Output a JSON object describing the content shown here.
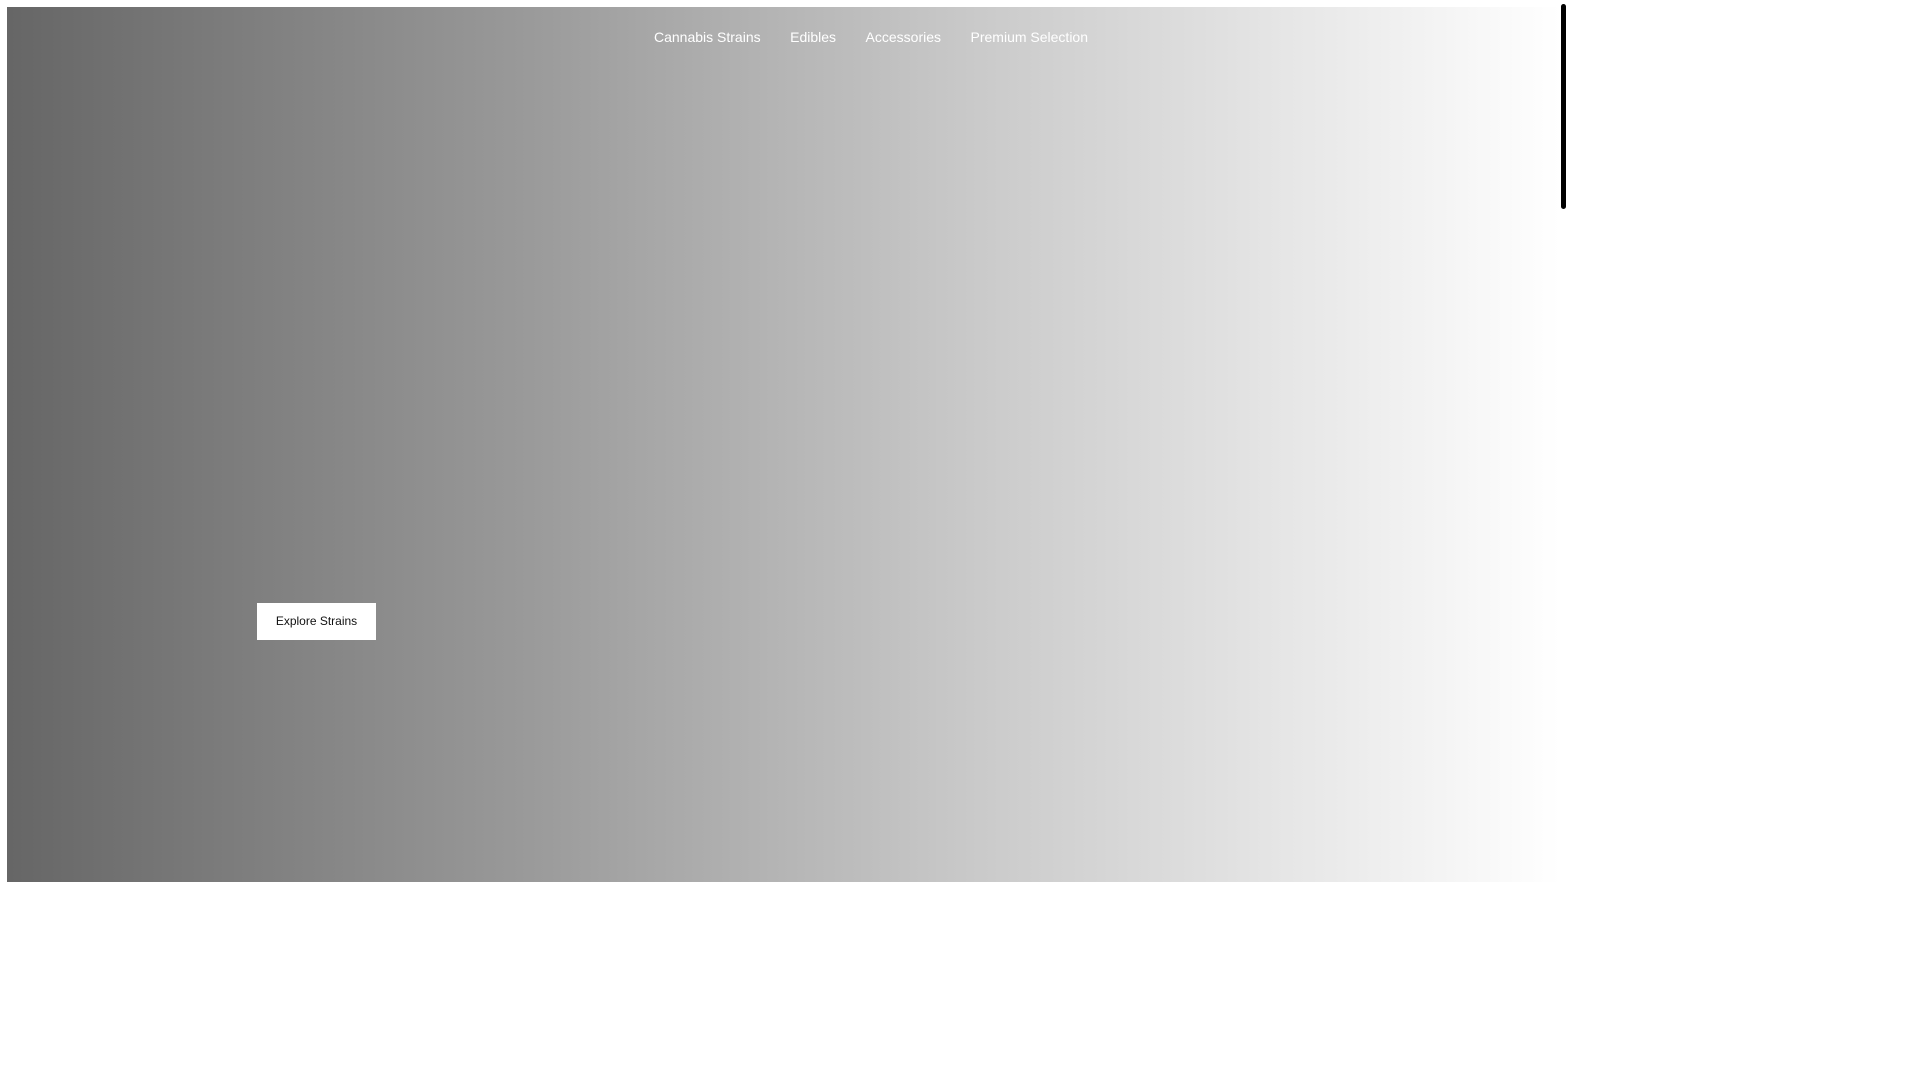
{
  "nav": {
    "items": [
      {
        "label": "Cannabis Strains"
      },
      {
        "label": "Edibles"
      },
      {
        "label": "Accessories"
      },
      {
        "label": "Premium Selection"
      }
    ]
  },
  "hero": {
    "cta_label": "Explore Strains"
  },
  "colors": {
    "gradient_start": "#666666",
    "gradient_end": "#ffffff",
    "nav_text": "#ffffff",
    "button_bg": "#ffffff",
    "button_text": "#111111"
  }
}
